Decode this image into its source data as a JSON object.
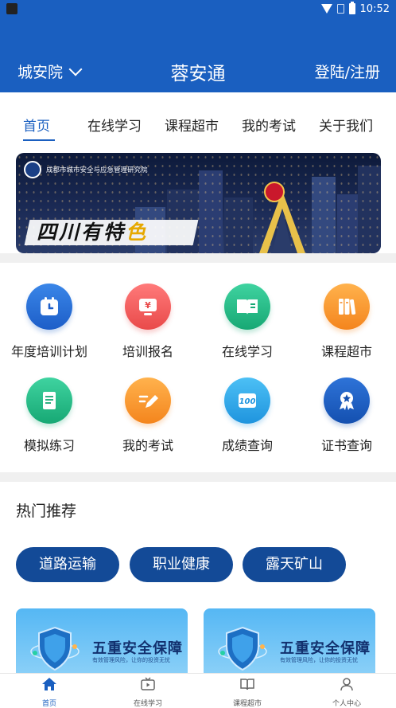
{
  "status_bar": {
    "time": "10:52"
  },
  "header": {
    "location": "城安院",
    "title": "蓉安通",
    "login": "登陆/注册",
    "color": "#1a5fc0"
  },
  "tabs": [
    {
      "label": "首页",
      "active": true
    },
    {
      "label": "在线学习"
    },
    {
      "label": "课程超市"
    },
    {
      "label": "我的考试"
    },
    {
      "label": "关于我们"
    }
  ],
  "banner": {
    "org": "成都市城市安全与应急管理研究院",
    "slogan_a": "四川有特",
    "slogan_b": "色"
  },
  "grid": [
    {
      "label": "年度培训计划",
      "icon": "calendar-icon",
      "color": "#1d5ec8"
    },
    {
      "label": "培训报名",
      "icon": "yuan-monitor-icon",
      "color": "#e94a4a"
    },
    {
      "label": "在线学习",
      "icon": "open-book-icon",
      "color": "#17a874"
    },
    {
      "label": "课程超市",
      "icon": "books-icon",
      "color": "#f4851d"
    },
    {
      "label": "模拟练习",
      "icon": "document-icon",
      "color": "#17a874"
    },
    {
      "label": "我的考试",
      "icon": "edit-pen-icon",
      "color": "#f4851d"
    },
    {
      "label": "成绩查询",
      "icon": "score-100-icon",
      "color": "#1f94de"
    },
    {
      "label": "证书查询",
      "icon": "medal-icon",
      "color": "#1450b0"
    }
  ],
  "hot": {
    "title": "热门推荐",
    "pills": [
      "道路运输",
      "职业健康",
      "露天矿山"
    ],
    "cards": [
      {
        "title": "五重安全保障",
        "subtitle": "有效管理风险，让你的投资无忧"
      },
      {
        "title": "五重安全保障",
        "subtitle": "有效管理风险，让你的投资无忧"
      }
    ]
  },
  "bottom_nav": [
    {
      "label": "首页",
      "icon": "home-icon",
      "active": true
    },
    {
      "label": "在线学习",
      "icon": "tv-play-icon"
    },
    {
      "label": "课程超市",
      "icon": "book-icon"
    },
    {
      "label": "个人中心",
      "icon": "user-icon"
    }
  ]
}
